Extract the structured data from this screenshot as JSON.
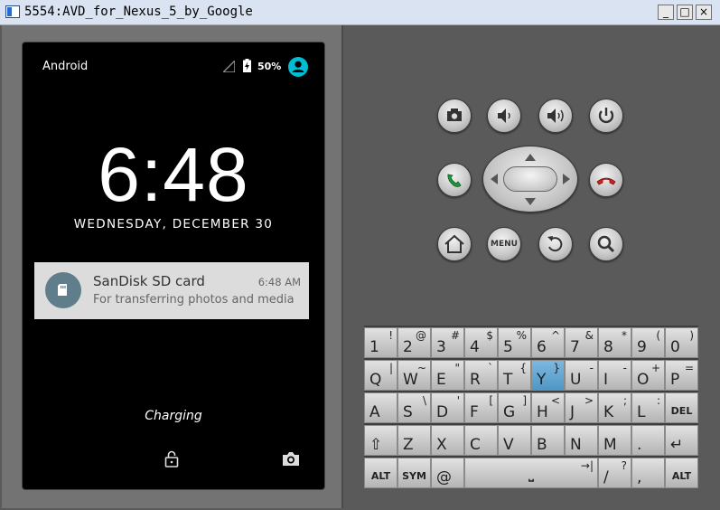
{
  "window": {
    "title": "5554:AVD_for_Nexus_5_by_Google",
    "buttons": {
      "minimize": "_",
      "maximize": "□",
      "close": "×"
    }
  },
  "phone": {
    "status": {
      "carrier": "Android",
      "battery": "50%"
    },
    "clock": "6:48",
    "date": "WEDNESDAY, DECEMBER 30",
    "notification": {
      "title": "SanDisk SD card",
      "time": "6:48 AM",
      "text": "For transferring photos and media"
    },
    "charging": "Charging"
  },
  "controls": {
    "menu_label": "MENU"
  },
  "colors": {
    "accent": "#00bcd4",
    "call_green": "#1a9a3a",
    "call_red": "#d42020",
    "key_highlight": "#5aa0d0"
  },
  "keyboard": {
    "rows": [
      [
        {
          "m": "1",
          "s": "!"
        },
        {
          "m": "2",
          "s": "@"
        },
        {
          "m": "3",
          "s": "#"
        },
        {
          "m": "4",
          "s": "$"
        },
        {
          "m": "5",
          "s": "%"
        },
        {
          "m": "6",
          "s": "^"
        },
        {
          "m": "7",
          "s": "&"
        },
        {
          "m": "8",
          "s": "*"
        },
        {
          "m": "9",
          "s": "("
        },
        {
          "m": "0",
          "s": ")"
        }
      ],
      [
        {
          "m": "Q",
          "s": "|"
        },
        {
          "m": "W",
          "s": "~"
        },
        {
          "m": "E",
          "s": "\""
        },
        {
          "m": "R",
          "s": "`"
        },
        {
          "m": "T",
          "s": "{"
        },
        {
          "m": "Y",
          "s": "}"
        },
        {
          "m": "U",
          "s": "-"
        },
        {
          "m": "I",
          "s": "-"
        },
        {
          "m": "O",
          "s": "+"
        },
        {
          "m": "P",
          "s": "="
        }
      ],
      [
        {
          "m": "A",
          "s": ""
        },
        {
          "m": "S",
          "s": "\\"
        },
        {
          "m": "D",
          "s": "'"
        },
        {
          "m": "F",
          "s": "["
        },
        {
          "m": "G",
          "s": "]"
        },
        {
          "m": "H",
          "s": "<"
        },
        {
          "m": "J",
          "s": ">"
        },
        {
          "m": "K",
          "s": ";"
        },
        {
          "m": "L",
          "s": ":"
        },
        {
          "m": "DEL",
          "s": ""
        }
      ],
      [
        {
          "m": "⇧",
          "s": ""
        },
        {
          "m": "Z",
          "s": ""
        },
        {
          "m": "X",
          "s": ""
        },
        {
          "m": "C",
          "s": ""
        },
        {
          "m": "V",
          "s": ""
        },
        {
          "m": "B",
          "s": ""
        },
        {
          "m": "N",
          "s": ""
        },
        {
          "m": "M",
          "s": ""
        },
        {
          "m": ".",
          "s": ""
        },
        {
          "m": "↵",
          "s": ""
        }
      ],
      [
        {
          "m": "ALT",
          "s": ""
        },
        {
          "m": "SYM",
          "s": ""
        },
        {
          "m": "@",
          "s": ""
        },
        {
          "m": "⎵",
          "s": "→|"
        },
        {
          "m": "/",
          "s": "?"
        },
        {
          "m": ",",
          "s": ""
        },
        {
          "m": "ALT",
          "s": ""
        }
      ]
    ]
  }
}
